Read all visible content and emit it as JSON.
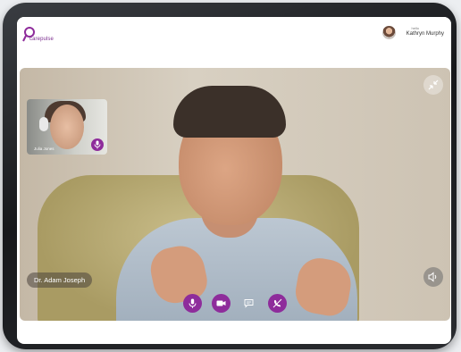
{
  "app": {
    "logo_text": "carepulse",
    "brand_color": "#8e2c9b"
  },
  "header": {
    "greeting": "hello",
    "user_name": "Kathryn Murphy"
  },
  "call": {
    "main_participant": "Dr. Adam Joseph",
    "self_view_name": "Julia Jones"
  },
  "icons": {
    "minimize": "minimize-icon",
    "volume": "volume-icon",
    "mic": "mic-icon",
    "camera": "video-camera-icon",
    "chat": "chat-icon",
    "end_call": "end-call-icon"
  }
}
